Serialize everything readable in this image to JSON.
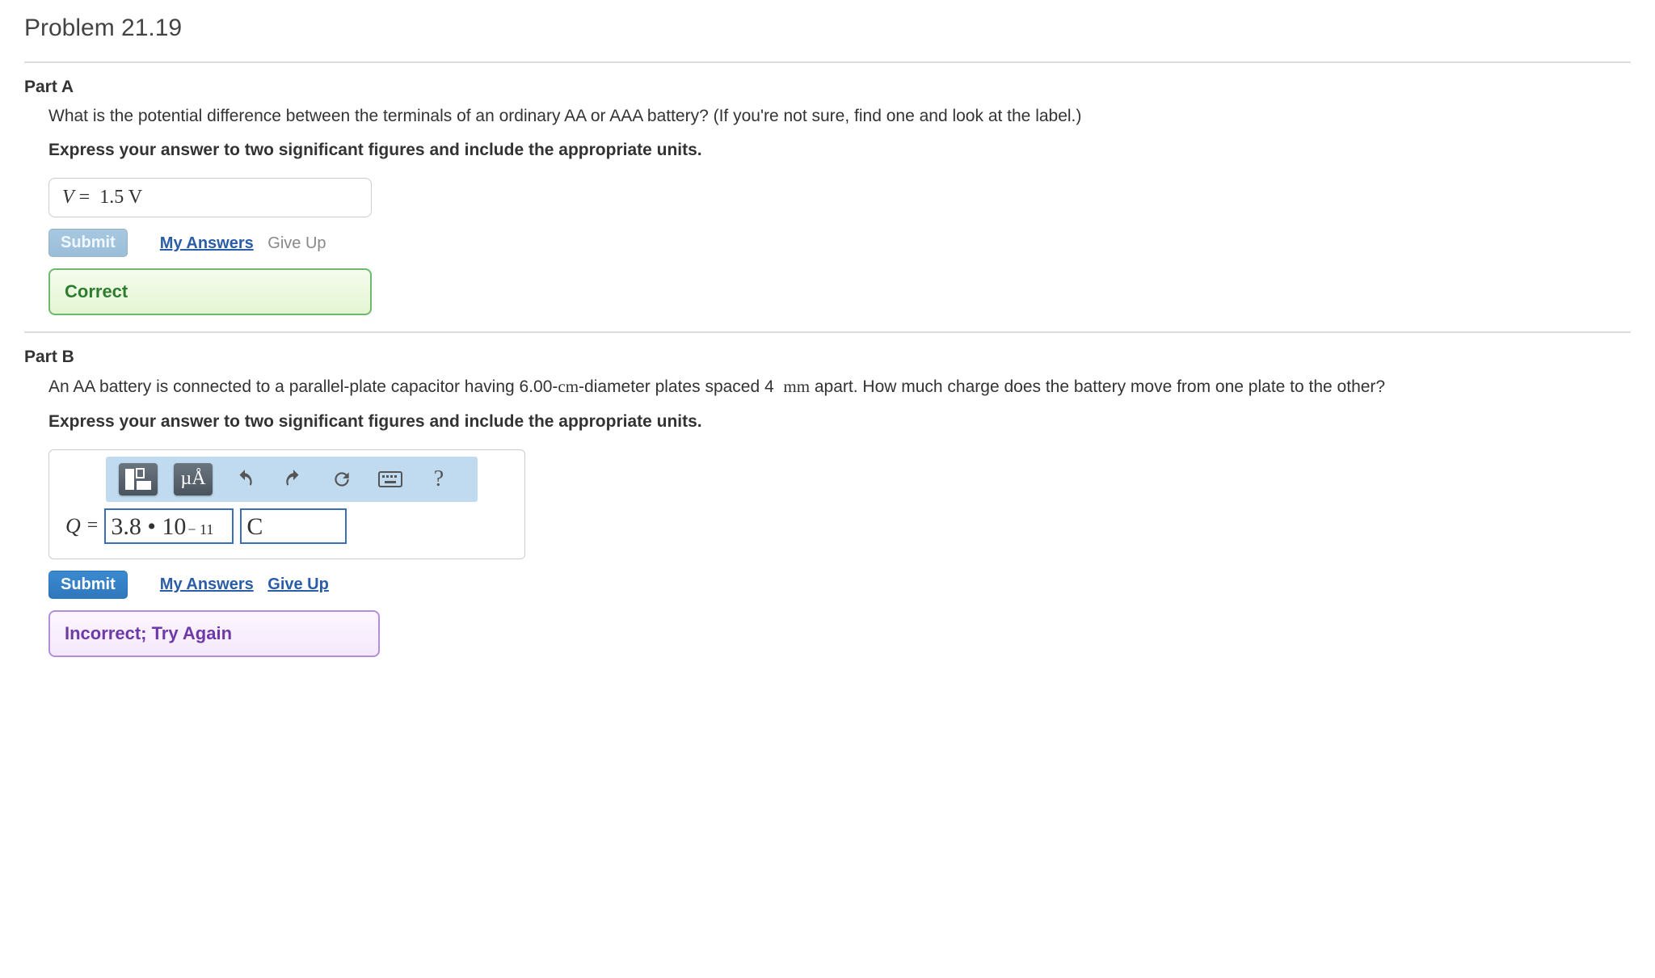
{
  "problem_title": "Problem 21.19",
  "partA": {
    "header": "Part A",
    "question": "What is the potential difference between the terminals of an ordinary AA or AAA battery? (If you're not sure, find one and look at the label.)",
    "instruction": "Express your answer to two significant figures and include the appropriate units.",
    "answer_var": "V",
    "answer_eq": "=",
    "answer_value": "1.5 V",
    "submit_label": "Submit",
    "my_answers_label": "My Answers",
    "give_up_label": "Give Up",
    "feedback": "Correct"
  },
  "partB": {
    "header": "Part B",
    "question_pre": "An AA battery is connected to a parallel-plate capacitor having 6.00-",
    "question_unit1": "cm",
    "question_mid": "-diameter plates spaced 4 ",
    "question_unit2": "mm",
    "question_post": " apart. How much charge does the battery move from one plate to the other?",
    "instruction": "Express your answer to two significant figures and include the appropriate units.",
    "toolbar": {
      "units_btn": "µÅ",
      "help": "?"
    },
    "answer_var": "Q",
    "answer_eq": "=",
    "answer_value_base": "3.8 • 10",
    "answer_value_exp": "− 11",
    "answer_unit": "C",
    "submit_label": "Submit",
    "my_answers_label": "My Answers",
    "give_up_label": "Give Up",
    "feedback": "Incorrect; Try Again"
  }
}
